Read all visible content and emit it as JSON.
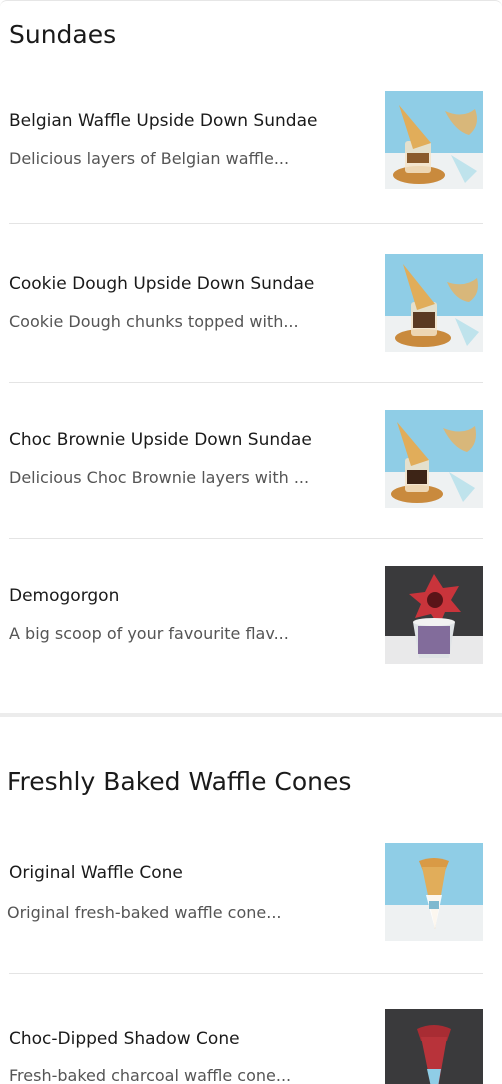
{
  "sections": [
    {
      "title": "Sundaes",
      "items": [
        {
          "name": "Belgian Waffle Upside Down Sundae",
          "description": "Delicious layers of Belgian waffle...",
          "image": "upside-down-sundae-photo"
        },
        {
          "name": "Cookie Dough Upside Down Sundae",
          "description": "Cookie Dough chunks topped with...",
          "image": "upside-down-sundae-photo"
        },
        {
          "name": "Choc Brownie Upside Down Sundae",
          "description": "Delicious Choc Brownie layers with ...",
          "image": "upside-down-sundae-photo"
        },
        {
          "name": "Demogorgon",
          "description": "A big scoop of your favourite flav...",
          "image": "demogorgon-cup-photo"
        }
      ]
    },
    {
      "title": "Freshly Baked Waffle Cones",
      "items": [
        {
          "name": "Original Waffle Cone",
          "description": "Original fresh-baked waffle cone...",
          "image": "waffle-cone-photo"
        },
        {
          "name": "Choc-Dipped Shadow Cone",
          "description": "Fresh-baked charcoal waffle cone...",
          "image": "shadow-cone-photo"
        }
      ]
    }
  ],
  "colors": {
    "text": "#1a1a1a",
    "muted": "#555555",
    "divider": "#e4e4e4",
    "photo_blue": "#8fcde6",
    "photo_dark": "#3a3a3c"
  }
}
